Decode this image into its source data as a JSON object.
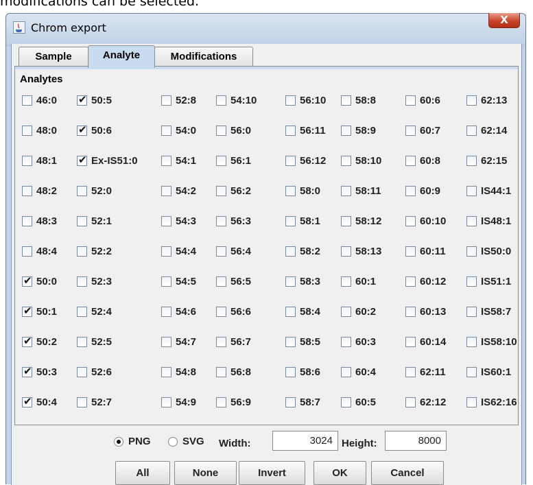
{
  "top_text": "modifications can be selected.",
  "window": {
    "title": "Chrom export",
    "close_label": "X"
  },
  "tabs": [
    {
      "label": "Sample",
      "active": false
    },
    {
      "label": "Analyte",
      "active": true
    },
    {
      "label": "Modifications",
      "active": false
    }
  ],
  "analytes": {
    "label": "Analytes",
    "columns": [
      {
        "items": [
          {
            "label": "46:0",
            "checked": false
          },
          {
            "label": "48:0",
            "checked": false
          },
          {
            "label": "48:1",
            "checked": false
          },
          {
            "label": "48:2",
            "checked": false
          },
          {
            "label": "48:3",
            "checked": false
          },
          {
            "label": "48:4",
            "checked": false
          },
          {
            "label": "50:0",
            "checked": true
          },
          {
            "label": "50:1",
            "checked": true
          },
          {
            "label": "50:2",
            "checked": true
          },
          {
            "label": "50:3",
            "checked": true
          },
          {
            "label": "50:4",
            "checked": true
          }
        ]
      },
      {
        "items": [
          {
            "label": "50:5",
            "checked": true
          },
          {
            "label": "50:6",
            "checked": true
          },
          {
            "label": "Ex-IS51:0",
            "checked": true
          },
          {
            "label": "52:0",
            "checked": false
          },
          {
            "label": "52:1",
            "checked": false
          },
          {
            "label": "52:2",
            "checked": false
          },
          {
            "label": "52:3",
            "checked": false
          },
          {
            "label": "52:4",
            "checked": false
          },
          {
            "label": "52:5",
            "checked": false
          },
          {
            "label": "52:6",
            "checked": false
          },
          {
            "label": "52:7",
            "checked": false
          }
        ]
      },
      {
        "items": [
          {
            "label": "52:8",
            "checked": false
          },
          {
            "label": "54:0",
            "checked": false
          },
          {
            "label": "54:1",
            "checked": false
          },
          {
            "label": "54:2",
            "checked": false
          },
          {
            "label": "54:3",
            "checked": false
          },
          {
            "label": "54:4",
            "checked": false
          },
          {
            "label": "54:5",
            "checked": false
          },
          {
            "label": "54:6",
            "checked": false
          },
          {
            "label": "54:7",
            "checked": false
          },
          {
            "label": "54:8",
            "checked": false
          },
          {
            "label": "54:9",
            "checked": false
          }
        ]
      },
      {
        "items": [
          {
            "label": "54:10",
            "checked": false
          },
          {
            "label": "56:0",
            "checked": false
          },
          {
            "label": "56:1",
            "checked": false
          },
          {
            "label": "56:2",
            "checked": false
          },
          {
            "label": "56:3",
            "checked": false
          },
          {
            "label": "56:4",
            "checked": false
          },
          {
            "label": "56:5",
            "checked": false
          },
          {
            "label": "56:6",
            "checked": false
          },
          {
            "label": "56:7",
            "checked": false
          },
          {
            "label": "56:8",
            "checked": false
          },
          {
            "label": "56:9",
            "checked": false
          }
        ]
      },
      {
        "items": [
          {
            "label": "56:10",
            "checked": false
          },
          {
            "label": "56:11",
            "checked": false
          },
          {
            "label": "56:12",
            "checked": false
          },
          {
            "label": "58:0",
            "checked": false
          },
          {
            "label": "58:1",
            "checked": false
          },
          {
            "label": "58:2",
            "checked": false
          },
          {
            "label": "58:3",
            "checked": false
          },
          {
            "label": "58:4",
            "checked": false
          },
          {
            "label": "58:5",
            "checked": false
          },
          {
            "label": "58:6",
            "checked": false
          },
          {
            "label": "58:7",
            "checked": false
          }
        ]
      },
      {
        "items": [
          {
            "label": "58:8",
            "checked": false
          },
          {
            "label": "58:9",
            "checked": false
          },
          {
            "label": "58:10",
            "checked": false
          },
          {
            "label": "58:11",
            "checked": false
          },
          {
            "label": "58:12",
            "checked": false
          },
          {
            "label": "58:13",
            "checked": false
          },
          {
            "label": "60:1",
            "checked": false
          },
          {
            "label": "60:2",
            "checked": false
          },
          {
            "label": "60:3",
            "checked": false
          },
          {
            "label": "60:4",
            "checked": false
          },
          {
            "label": "60:5",
            "checked": false
          }
        ]
      },
      {
        "items": [
          {
            "label": "60:6",
            "checked": false
          },
          {
            "label": "60:7",
            "checked": false
          },
          {
            "label": "60:8",
            "checked": false
          },
          {
            "label": "60:9",
            "checked": false
          },
          {
            "label": "60:10",
            "checked": false
          },
          {
            "label": "60:11",
            "checked": false
          },
          {
            "label": "60:12",
            "checked": false
          },
          {
            "label": "60:13",
            "checked": false
          },
          {
            "label": "60:14",
            "checked": false
          },
          {
            "label": "62:11",
            "checked": false
          },
          {
            "label": "62:12",
            "checked": false
          }
        ]
      },
      {
        "items": [
          {
            "label": "62:13",
            "checked": false
          },
          {
            "label": "62:14",
            "checked": false
          },
          {
            "label": "62:15",
            "checked": false
          },
          {
            "label": "IS44:1",
            "checked": false
          },
          {
            "label": "IS48:1",
            "checked": false
          },
          {
            "label": "IS50:0",
            "checked": false
          },
          {
            "label": "IS51:1",
            "checked": false
          },
          {
            "label": "IS58:7",
            "checked": false
          },
          {
            "label": "IS58:10",
            "checked": false
          },
          {
            "label": "IS60:1",
            "checked": false
          },
          {
            "label": "IS62:16",
            "checked": false
          }
        ]
      }
    ]
  },
  "format": {
    "png_label": "PNG",
    "png_selected": true,
    "svg_label": "SVG",
    "svg_selected": false,
    "width_label": "Width:",
    "width_value": "3024",
    "height_label": "Height:",
    "height_value": "8000"
  },
  "buttons": {
    "all": "All",
    "none": "None",
    "invert": "Invert",
    "ok": "OK",
    "cancel": "Cancel"
  }
}
